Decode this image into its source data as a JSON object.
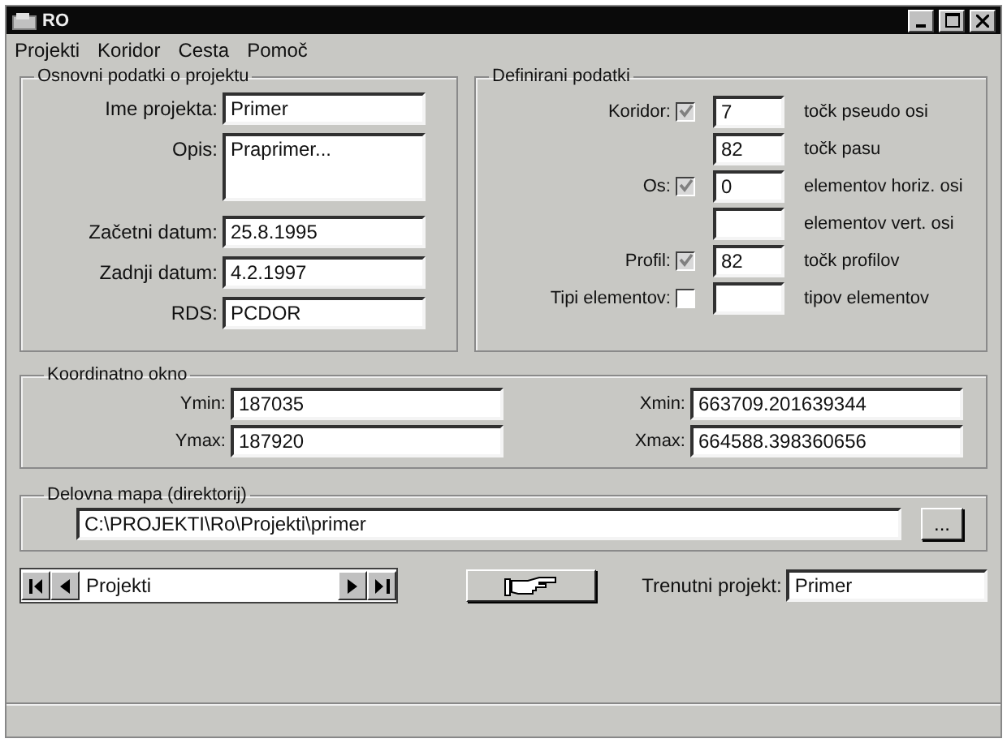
{
  "window": {
    "title": "RO"
  },
  "menu": [
    {
      "label": "Projekti"
    },
    {
      "label": "Koridor"
    },
    {
      "label": "Cesta"
    },
    {
      "label": "Pomoč"
    }
  ],
  "project": {
    "title": "Osnovni podatki o projektu",
    "fields": [
      {
        "label": "Ime projekta:",
        "value": "Primer",
        "kind": "text"
      },
      {
        "label": "Opis:",
        "value": "Praprimer...",
        "kind": "multiline"
      },
      {
        "label": "Začetni datum:",
        "value": "25.8.1995",
        "kind": "text"
      },
      {
        "label": "Zadnji datum:",
        "value": "4.2.1997",
        "kind": "text"
      },
      {
        "label": "RDS:",
        "value": "PCDOR",
        "kind": "text"
      }
    ]
  },
  "defined": {
    "title": "Definirani podatki",
    "rows": [
      {
        "label": "Koridor:",
        "checkbox": {
          "checked": true,
          "disabled": true
        },
        "value": "7",
        "unit": "točk pseudo osi"
      },
      {
        "value": "82",
        "unit": "točk pasu"
      },
      {
        "label": "Os:",
        "checkbox": {
          "checked": true,
          "disabled": true
        },
        "value": "0",
        "unit": "elementov horiz. osi"
      },
      {
        "unit": "elementov vert. osi"
      },
      {
        "label": "Profil:",
        "checkbox": {
          "checked": true,
          "disabled": true
        },
        "value": "82",
        "unit": "točk profilov"
      },
      {
        "label": "Tipi elementov:",
        "checkbox": {
          "checked": false,
          "disabled": false
        },
        "unit": "tipov elementov"
      }
    ]
  },
  "coordinates": {
    "title": "Koordinatno okno",
    "fields": [
      {
        "label": "Ymin:",
        "value": "187035"
      },
      {
        "label": "Xmin:",
        "value": "663709.201639344"
      },
      {
        "label": "Ymax:",
        "value": "187920"
      },
      {
        "label": "Xmax:",
        "value": "664588.398360656"
      }
    ]
  },
  "directory": {
    "title": "Delovna mapa (direktorij)",
    "value": "C:\\PROJEKTI\\Ro\\Projekti\\primer",
    "browse_label": "..."
  },
  "navigator": {
    "caption": "Projekti"
  },
  "current_project": {
    "label": "Trenutni projekt:",
    "value": "Primer"
  }
}
